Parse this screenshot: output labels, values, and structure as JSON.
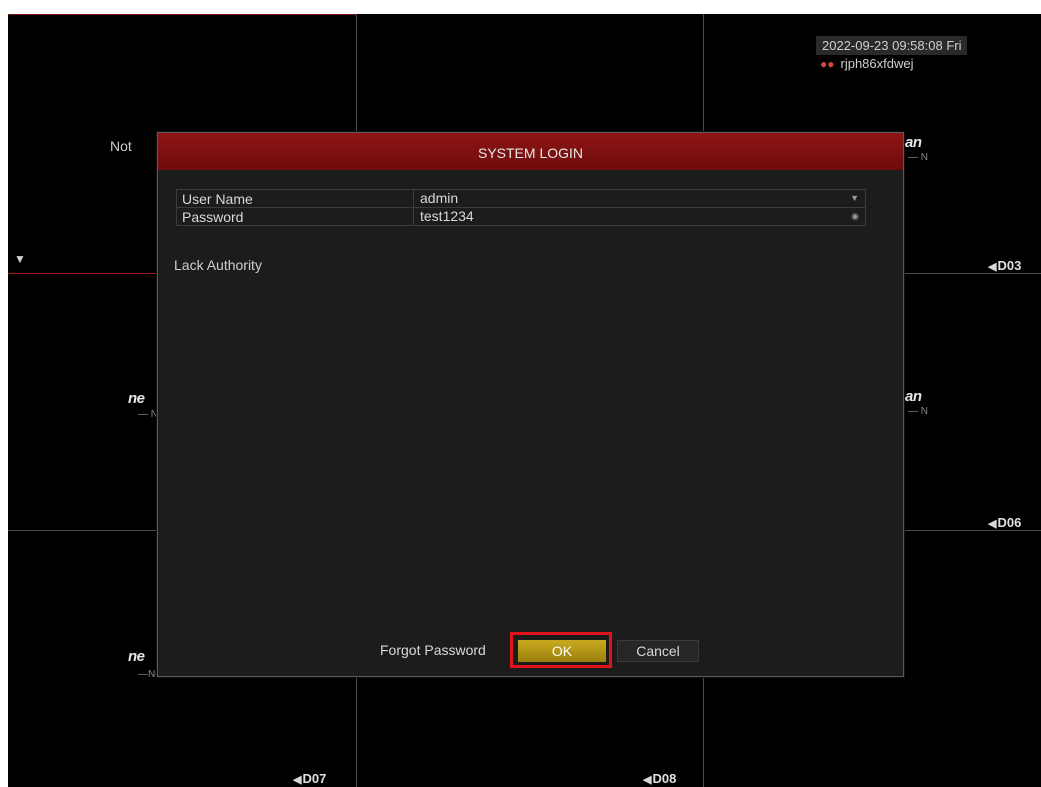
{
  "osd": {
    "datetime": "2022-09-23 09:58:08 Fri",
    "device_name": "rjph86xfdwej",
    "cell1_status": "Not",
    "logo_partial_left": "ne",
    "logo_partial_right": "an",
    "no_video_partial": "— N",
    "no_video_partial2": "— N",
    "no_video_partial3": "— N",
    "no_video_partial4": "—No Video",
    "channels": {
      "d03": "D03",
      "d06": "D06",
      "d07": "D07",
      "d08": "D08"
    }
  },
  "dialog": {
    "title": "SYSTEM LOGIN",
    "fields": {
      "username_label": "User Name",
      "username_value": "admin",
      "password_label": "Password",
      "password_value": "test1234"
    },
    "status_message": "Lack Authority",
    "forgot_password": "Forgot Password",
    "ok_label": "OK",
    "cancel_label": "Cancel"
  },
  "colors": {
    "titlebar": "#8e1515",
    "ok_button": "#c9aa1e",
    "highlight": "#e0141a"
  },
  "icons": {
    "user_icon": "users-icon",
    "dropdown": "chevron-down-icon",
    "show_password": "eye-icon",
    "camera": "camera-icon",
    "cursor": "mouse-pointer-icon"
  }
}
